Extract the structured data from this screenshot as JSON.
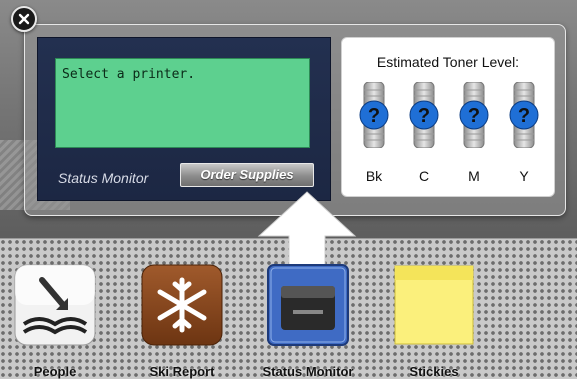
{
  "widget": {
    "lcd_text": "Select a printer.",
    "status_label": "Status Monitor",
    "order_button": "Order Supplies",
    "toner": {
      "title": "Estimated Toner Level:",
      "cartridges": [
        {
          "label": "Bk",
          "level": "unknown"
        },
        {
          "label": "C",
          "level": "unknown"
        },
        {
          "label": "M",
          "level": "unknown"
        },
        {
          "label": "Y",
          "level": "unknown"
        }
      ]
    }
  },
  "dock": {
    "items": [
      {
        "label": "People",
        "icon": "people-book-icon"
      },
      {
        "label": "Ski Report",
        "icon": "snowflake-icon"
      },
      {
        "label": "Status Monitor",
        "icon": "printer-icon"
      },
      {
        "label": "Stickies",
        "icon": "sticky-note-icon"
      }
    ]
  },
  "colors": {
    "lcd": "#5dd08f",
    "panel": "#233050",
    "cartridge_question": "#1f6fd6"
  }
}
